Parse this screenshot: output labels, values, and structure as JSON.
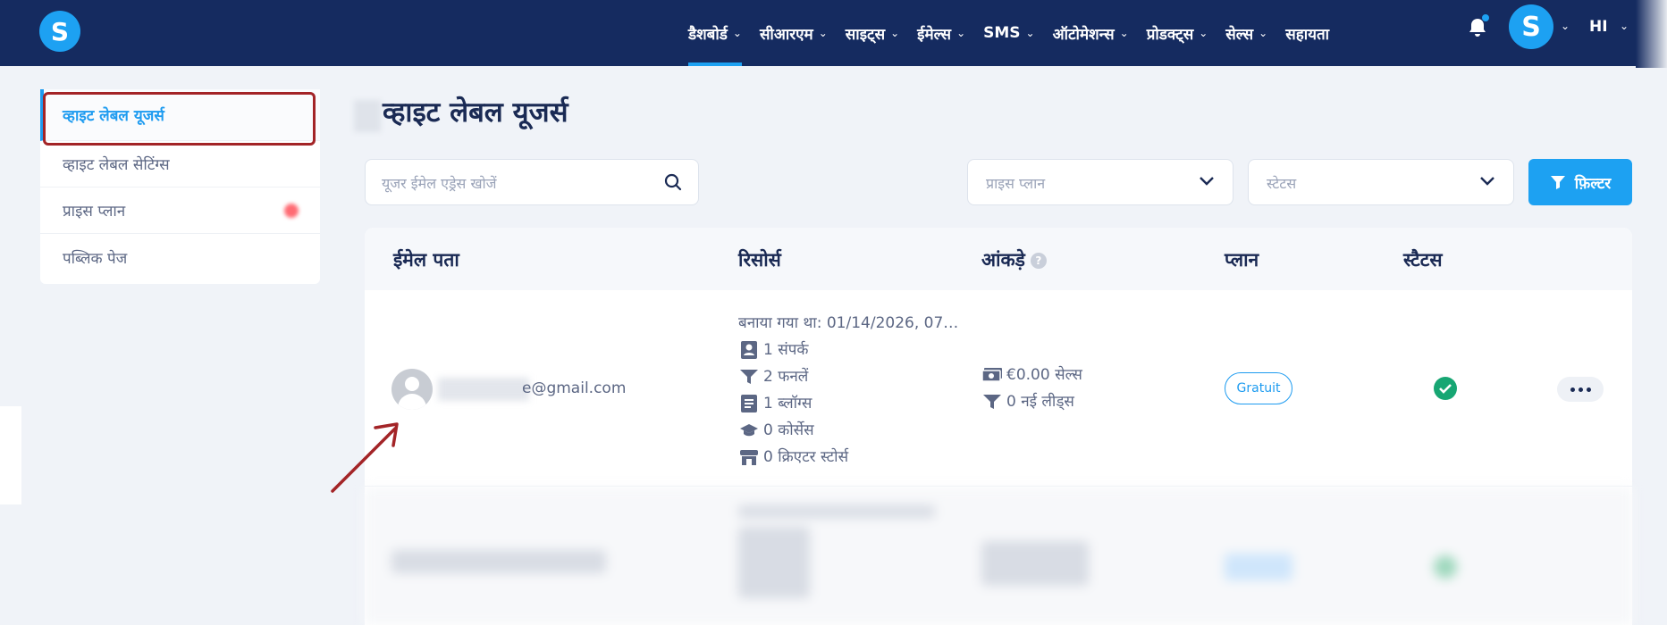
{
  "app": {
    "logo_letter": "S"
  },
  "nav": {
    "items": [
      {
        "label": "डैशबोर्ड",
        "active": true,
        "has_dropdown": true
      },
      {
        "label": "सीआरएम",
        "has_dropdown": true
      },
      {
        "label": "साइट्स",
        "has_dropdown": true
      },
      {
        "label": "ईमेल्स",
        "has_dropdown": true
      },
      {
        "label": "SMS",
        "has_dropdown": true
      },
      {
        "label": "ऑटोमेशन्स",
        "has_dropdown": true
      },
      {
        "label": "प्रोडक्ट्स",
        "has_dropdown": true
      },
      {
        "label": "सेल्स",
        "has_dropdown": true
      },
      {
        "label": "सहायता",
        "has_dropdown": false
      }
    ],
    "notifications_icon": "bell-icon",
    "avatar_letter": "S",
    "language": "HI",
    "accent_color": "#1da1f2",
    "bar_color": "#152b60"
  },
  "sidebar": {
    "items": [
      {
        "label": "व्हाइट लेबल यूजर्स",
        "active": true
      },
      {
        "label": "व्हाइट लेबल सेटिंग्स"
      },
      {
        "label": "प्राइस प्लान"
      },
      {
        "label": "पब्लिक पेज"
      }
    ]
  },
  "page": {
    "title": "व्हाइट लेबल यूजर्स"
  },
  "filters": {
    "search_placeholder": "यूजर ईमेल एड्रेस खोजें",
    "plan_placeholder": "प्राइस प्लान",
    "status_placeholder": "स्टेटस",
    "filter_button": "फ़िल्टर"
  },
  "table": {
    "columns": [
      "ईमेल पता",
      "रिसोर्स",
      "आंकड़े",
      "प्लान",
      "स्टैटस"
    ],
    "stats_help": "?",
    "rows": [
      {
        "email_suffix": "e@gmail.com",
        "created": "बनाया गया था: 01/14/2026, 07…",
        "resources": [
          {
            "icon": "contact-card-icon",
            "text": "1 संपर्क"
          },
          {
            "icon": "funnel-icon",
            "text": "2 फनलें"
          },
          {
            "icon": "document-icon",
            "text": "1 ब्लॉग्स"
          },
          {
            "icon": "graduation-cap-icon",
            "text": "0 कोर्सेस"
          },
          {
            "icon": "store-icon",
            "text": "0 क्रिएटर स्टोर्स"
          }
        ],
        "stats": [
          {
            "icon": "money-icon",
            "text": "€0.00 सेल्स"
          },
          {
            "icon": "funnel-icon",
            "text": "0 नई लीड्स"
          }
        ],
        "plan": "Gratuit",
        "status": "active",
        "status_color": "#17a673"
      }
    ]
  }
}
